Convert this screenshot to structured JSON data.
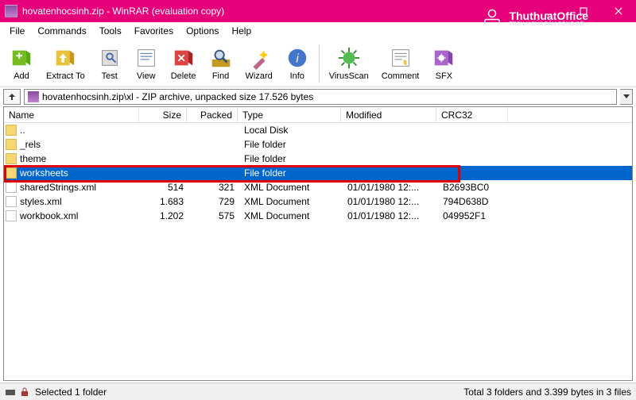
{
  "window": {
    "title": "hovatenhocsinh.zip - WinRAR (evaluation copy)"
  },
  "menu": {
    "items": [
      "File",
      "Commands",
      "Tools",
      "Favorites",
      "Options",
      "Help"
    ]
  },
  "toolbar": {
    "buttons": [
      {
        "name": "add-button",
        "label": "Add",
        "icon": "book-add"
      },
      {
        "name": "extract-button",
        "label": "Extract To",
        "icon": "book-extract"
      },
      {
        "name": "test-button",
        "label": "Test",
        "icon": "test"
      },
      {
        "name": "view-button",
        "label": "View",
        "icon": "view"
      },
      {
        "name": "delete-button",
        "label": "Delete",
        "icon": "delete"
      },
      {
        "name": "find-button",
        "label": "Find",
        "icon": "find"
      },
      {
        "name": "wizard-button",
        "label": "Wizard",
        "icon": "wizard"
      },
      {
        "name": "info-button",
        "label": "Info",
        "icon": "info"
      },
      {
        "name": "virusscan-button",
        "label": "VirusScan",
        "icon": "virus"
      },
      {
        "name": "comment-button",
        "label": "Comment",
        "icon": "comment"
      },
      {
        "name": "sfx-button",
        "label": "SFX",
        "icon": "sfx"
      }
    ],
    "separators_after": [
      7
    ]
  },
  "pathbar": {
    "path": "hovatenhocsinh.zip\\xl - ZIP archive, unpacked size 17.526 bytes"
  },
  "columns": {
    "name": "Name",
    "size": "Size",
    "packed": "Packed",
    "type": "Type",
    "modified": "Modified",
    "crc": "CRC32"
  },
  "rows": [
    {
      "icon": "folderup",
      "name": "..",
      "size": "",
      "packed": "",
      "type": "Local Disk",
      "modified": "",
      "crc": "",
      "selected": false
    },
    {
      "icon": "folder",
      "name": "_rels",
      "size": "",
      "packed": "",
      "type": "File folder",
      "modified": "",
      "crc": "",
      "selected": false
    },
    {
      "icon": "folder",
      "name": "theme",
      "size": "",
      "packed": "",
      "type": "File folder",
      "modified": "",
      "crc": "",
      "selected": false
    },
    {
      "icon": "folder",
      "name": "worksheets",
      "size": "",
      "packed": "",
      "type": "File folder",
      "modified": "",
      "crc": "",
      "selected": true
    },
    {
      "icon": "file",
      "name": "sharedStrings.xml",
      "size": "514",
      "packed": "321",
      "type": "XML Document",
      "modified": "01/01/1980 12:...",
      "crc": "B2693BC0",
      "selected": false
    },
    {
      "icon": "file",
      "name": "styles.xml",
      "size": "1.683",
      "packed": "729",
      "type": "XML Document",
      "modified": "01/01/1980 12:...",
      "crc": "794D638D",
      "selected": false
    },
    {
      "icon": "file",
      "name": "workbook.xml",
      "size": "1.202",
      "packed": "575",
      "type": "XML Document",
      "modified": "01/01/1980 12:...",
      "crc": "049952F1",
      "selected": false
    }
  ],
  "statusbar": {
    "selection": "Selected 1 folder",
    "total": "Total 3 folders and 3.399 bytes in 3 files"
  },
  "watermark": {
    "main": "ThuthuatOffice",
    "sub": "TRỢ LÝ CỦA DÂN CÔNG SỞ"
  }
}
